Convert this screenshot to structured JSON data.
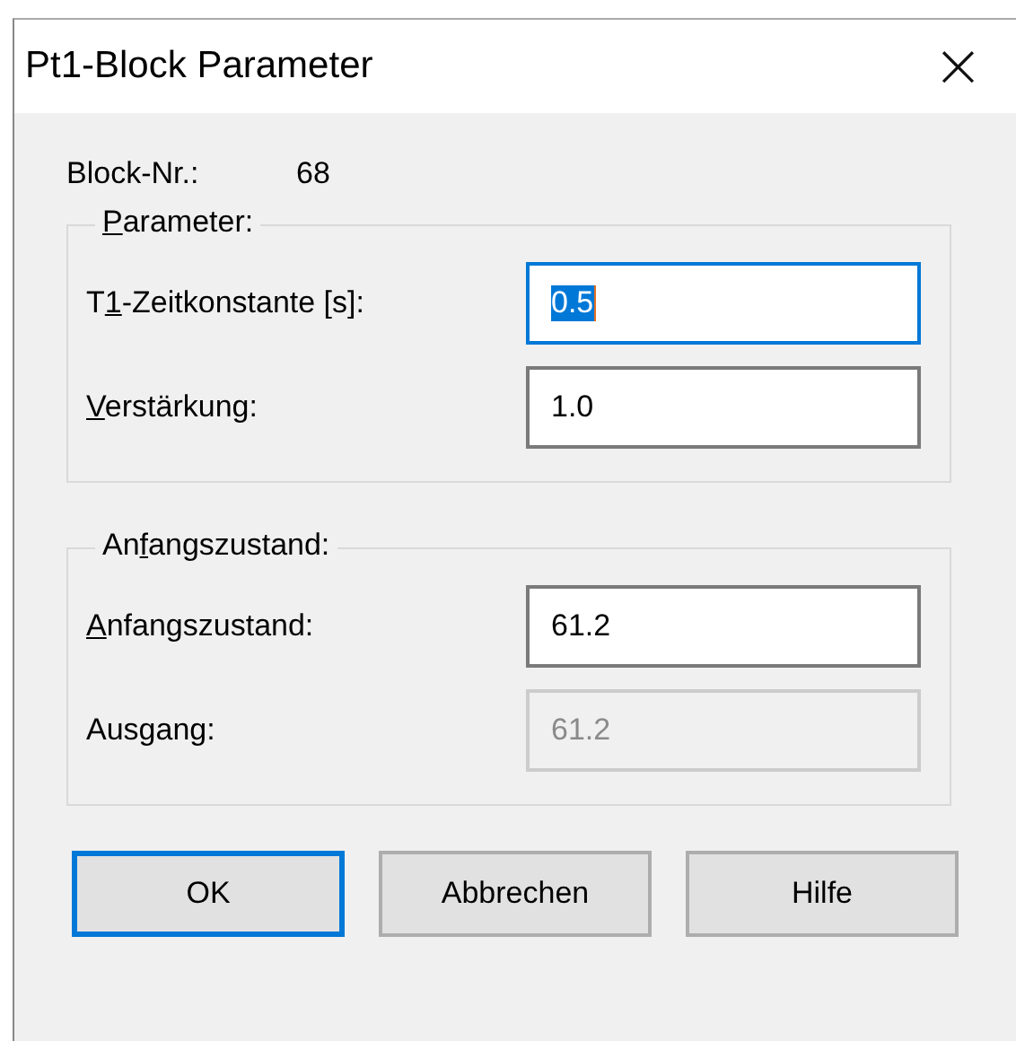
{
  "window": {
    "title": "Pt1-Block Parameter",
    "close": "×"
  },
  "block": {
    "label": "Block-Nr.:",
    "value": "68"
  },
  "groups": [
    {
      "legend": {
        "key": "P",
        "post": "arameter:"
      },
      "fields": [
        {
          "label": {
            "pre": "T",
            "key": "1",
            "post": "-Zeitkonstante [s]:"
          },
          "value": "0.5",
          "focused": true,
          "disabled": false
        },
        {
          "label": {
            "key": "V",
            "post": "erstärkung:"
          },
          "value": "1.0",
          "focused": false,
          "disabled": false
        }
      ]
    },
    {
      "legend": {
        "pre": "An",
        "key": "f",
        "post": "angszustand:"
      },
      "fields": [
        {
          "label": {
            "key": "A",
            "post": "nfangszustand:"
          },
          "value": "61.2",
          "focused": false,
          "disabled": false
        },
        {
          "label": {
            "pre": "Ausgang:"
          },
          "value": "61.2",
          "focused": false,
          "disabled": true
        }
      ]
    }
  ],
  "buttons": [
    {
      "label": "OK",
      "default": true
    },
    {
      "label": "Abbrechen",
      "default": false
    },
    {
      "label": "Hilfe",
      "default": false
    }
  ]
}
